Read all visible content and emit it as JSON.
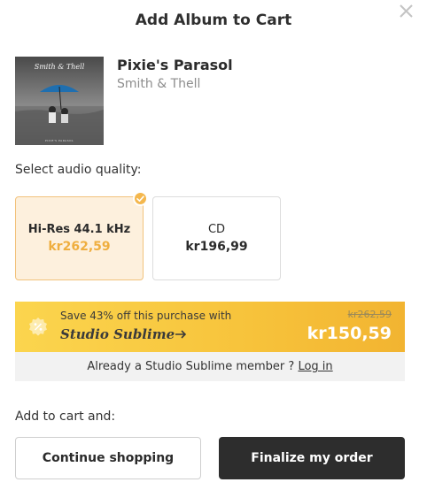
{
  "modal": {
    "title": "Add Album to Cart"
  },
  "album": {
    "name": "Pixie's Parasol",
    "artist": "Smith & Thell",
    "cover_script": "Smith & Thell",
    "cover_caption": "PIXIE'S PARASOL"
  },
  "quality": {
    "label": "Select audio quality:",
    "options": [
      {
        "name": "Hi-Res 44.1 kHz",
        "price": "kr262,59",
        "selected": true
      },
      {
        "name": "CD",
        "price": "kr196,99",
        "selected": false
      }
    ]
  },
  "promo": {
    "text": "Save 43% off this purchase with",
    "brand": "Studio Sublime",
    "old_price": "kr262,59",
    "new_price": "kr150,59",
    "accent_color": "#f7c33b"
  },
  "member": {
    "text": "Already a Studio Sublime member ? ",
    "link": "Log in"
  },
  "cart": {
    "label": "Add to cart and:",
    "continue_label": "Continue shopping",
    "finalize_label": "Finalize my order"
  },
  "icons": {
    "close": "close-icon",
    "check": "check-icon",
    "discount": "discount-badge-icon",
    "arrow": "arrow-right-icon"
  }
}
